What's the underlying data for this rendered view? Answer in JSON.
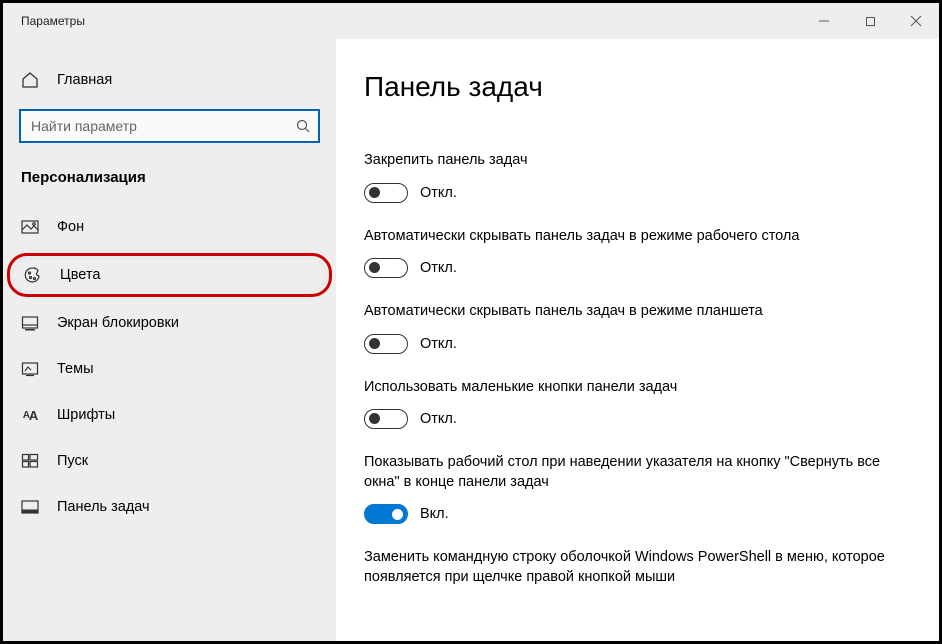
{
  "window": {
    "title": "Параметры"
  },
  "sidebar": {
    "home": "Главная",
    "search_placeholder": "Найти параметр",
    "section": "Персонализация",
    "items": [
      {
        "label": "Фон"
      },
      {
        "label": "Цвета"
      },
      {
        "label": "Экран блокировки"
      },
      {
        "label": "Темы"
      },
      {
        "label": "Шрифты"
      },
      {
        "label": "Пуск"
      },
      {
        "label": "Панель задач"
      }
    ]
  },
  "main": {
    "heading": "Панель задач",
    "settings": [
      {
        "label": "Закрепить панель задач",
        "on": false,
        "state": "Откл."
      },
      {
        "label": "Автоматически скрывать панель задач в режиме рабочего стола",
        "on": false,
        "state": "Откл."
      },
      {
        "label": "Автоматически скрывать панель задач в режиме планшета",
        "on": false,
        "state": "Откл."
      },
      {
        "label": "Использовать маленькие кнопки панели задач",
        "on": false,
        "state": "Откл."
      },
      {
        "label": "Показывать рабочий стол при наведении указателя на кнопку \"Свернуть все окна\" в конце панели задач",
        "on": true,
        "state": "Вкл."
      }
    ],
    "extra_text": "Заменить командную строку оболочкой Windows PowerShell в меню, которое появляется при щелчке правой кнопкой мыши"
  }
}
